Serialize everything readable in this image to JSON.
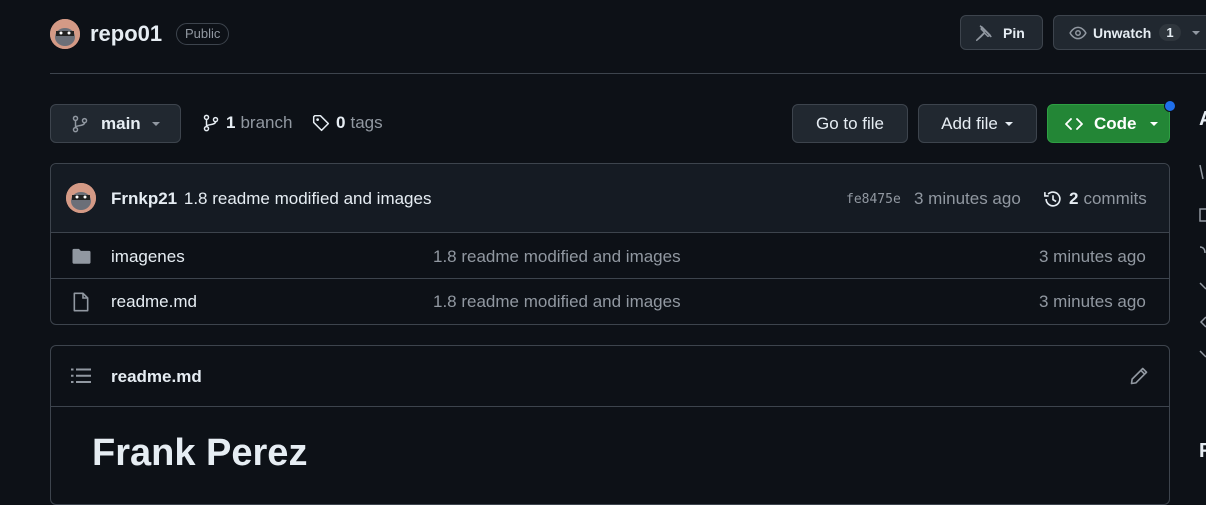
{
  "repo": {
    "name": "repo01",
    "visibility": "Public"
  },
  "actions": {
    "pin_label": "Pin",
    "unwatch_label": "Unwatch",
    "watch_count": "1"
  },
  "toolbar": {
    "branch_name": "main",
    "branch_count": "1",
    "branch_label": "branch",
    "tag_count": "0",
    "tag_label": "tags",
    "go_to_file": "Go to file",
    "add_file": "Add file",
    "code": "Code"
  },
  "latest_commit": {
    "author": "Frnkp21",
    "message": "1.8 readme modified and images",
    "sha": "fe8475e",
    "time": "3 minutes ago",
    "commit_count": "2",
    "commits_label": "commits"
  },
  "files": [
    {
      "name": "imagenes",
      "type": "folder",
      "message": "1.8 readme modified and images",
      "time": "3 minutes ago"
    },
    {
      "name": "readme.md",
      "type": "file",
      "message": "1.8 readme modified and images",
      "time": "3 minutes ago"
    }
  ],
  "readme": {
    "filename": "readme.md",
    "heading": "Frank Perez"
  },
  "sidebar_peek": {
    "about_initial": "A",
    "footer_initial": "F"
  },
  "colors": {
    "bg": "#0d1117",
    "accent_green": "#238636",
    "notification_dot": "#1f6feb"
  }
}
